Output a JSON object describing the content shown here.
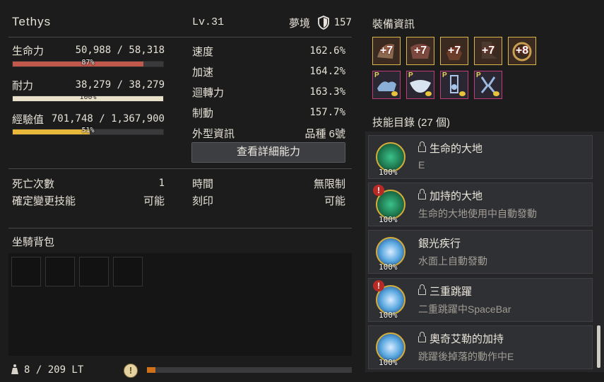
{
  "character": {
    "name": "Tethys",
    "level": "Lv.31",
    "realm_label": "夢境",
    "shield_value": "157"
  },
  "vitals": [
    {
      "label": "生命力",
      "value": "50,988 / 58,318",
      "percent_text": "87%",
      "fill": 0.87,
      "color": "#c0584c"
    },
    {
      "label": "耐力",
      "value": "38,279 / 38,279",
      "percent_text": "100%",
      "fill": 1.0,
      "color": "#e8e0c8"
    },
    {
      "label": "經驗值",
      "value": "701,748 / 1,367,900",
      "percent_text": "51%",
      "fill": 0.51,
      "color": "#e8b83a"
    }
  ],
  "stats": [
    {
      "label": "速度",
      "value": "162.6%"
    },
    {
      "label": "加速",
      "value": "164.2%"
    },
    {
      "label": "迴轉力",
      "value": "163.3%"
    },
    {
      "label": "制動",
      "value": "157.7%"
    },
    {
      "label": "外型資訊",
      "value": "品種 6號"
    }
  ],
  "detail_button": "查看詳細能力",
  "extra_left": [
    {
      "label": "死亡次數",
      "value": "1"
    },
    {
      "label": "確定變更技能",
      "value": "可能"
    }
  ],
  "extra_right": [
    {
      "label": "時間",
      "value": "無限制"
    },
    {
      "label": "刻印",
      "value": "可能"
    }
  ],
  "bag": {
    "title": "坐騎背包",
    "weight": "8 / 209 LT",
    "weight_fill": 0.04,
    "weight_color": "#d0701a"
  },
  "equipment": {
    "title": "裝備資訊",
    "row1": [
      {
        "plus": "+7",
        "icon": "tack-icon"
      },
      {
        "plus": "+7",
        "icon": "armor-icon"
      },
      {
        "plus": "+7",
        "icon": "saddle-icon"
      },
      {
        "plus": "+7",
        "icon": "shoes-icon"
      },
      {
        "plus": "+8",
        "icon": "stirrup-icon"
      }
    ],
    "row2": [
      {
        "mark": "P",
        "icon": "horse-armor-icon"
      },
      {
        "mark": "P",
        "icon": "horse-barding-icon"
      },
      {
        "mark": "P",
        "icon": "horse-saddle-icon"
      },
      {
        "mark": "P",
        "icon": "horse-horseshoe-icon"
      }
    ]
  },
  "skills": {
    "title": "技能目錄 (27 個)",
    "items": [
      {
        "name": "生命的大地",
        "desc": "E",
        "pct": "100%",
        "locked": true,
        "warn": false,
        "icon": "earth-skill-icon",
        "color": "#1f8a5a"
      },
      {
        "name": "加持的大地",
        "desc": "生命的大地使用中自動發動",
        "pct": "100%",
        "locked": true,
        "warn": true,
        "icon": "earth-blessing-icon",
        "color": "#1f8a5a"
      },
      {
        "name": "銀光疾行",
        "desc": "水面上自動發動",
        "pct": "100%",
        "locked": false,
        "warn": false,
        "icon": "silver-dash-icon",
        "color": "#5aa8e0"
      },
      {
        "name": "三重跳躍",
        "desc": "二重跳躍中SpaceBar",
        "pct": "100%",
        "locked": true,
        "warn": true,
        "icon": "triple-jump-icon",
        "color": "#5aa8e0"
      },
      {
        "name": "奧奇艾勒的加持",
        "desc": "跳躍後掉落的動作中E",
        "pct": "100%",
        "locked": true,
        "warn": false,
        "icon": "blessing-icon",
        "color": "#5aa8e0"
      }
    ]
  }
}
